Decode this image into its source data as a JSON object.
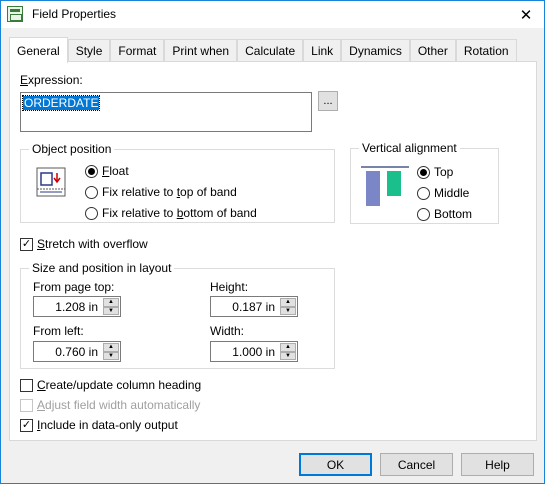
{
  "window": {
    "title": "Field Properties",
    "close_glyph": "✕"
  },
  "tabs": [
    {
      "label": "General",
      "active": true
    },
    {
      "label": "Style"
    },
    {
      "label": "Format"
    },
    {
      "label": "Print when"
    },
    {
      "label": "Calculate"
    },
    {
      "label": "Link"
    },
    {
      "label": "Dynamics"
    },
    {
      "label": "Other"
    },
    {
      "label": "Rotation"
    }
  ],
  "expression": {
    "label_underlined": "E",
    "label_rest": "xpression:",
    "value": "ORDERDATE",
    "browse_label": "..."
  },
  "object_position": {
    "title": "Object position",
    "icon": "object-position-icon",
    "options": [
      {
        "underlined": "F",
        "rest": "loat",
        "prefix": "",
        "selected": true
      },
      {
        "prefix": "Fix relative to ",
        "underlined": "t",
        "rest": "op of band",
        "selected": false
      },
      {
        "prefix": "Fix relative to ",
        "underlined": "b",
        "rest": "ottom of band",
        "selected": false
      }
    ]
  },
  "vertical_alignment": {
    "title": "Vertical alignment",
    "icon": "vertical-alignment-top-icon",
    "icon_colors": {
      "left_bar": "#7b86c6",
      "right_bar": "#1bbf8c",
      "top_line": "#4a5a8a"
    },
    "options": [
      {
        "label": "Top",
        "selected": true
      },
      {
        "label": "Middle",
        "selected": false
      },
      {
        "label": "Bottom",
        "selected": false
      }
    ]
  },
  "stretch": {
    "underlined": "S",
    "rest": "tretch with overflow",
    "checked": true
  },
  "size_position": {
    "title": "Size and position in layout",
    "from_page_top": {
      "label": "From page top:",
      "value": "1.208 in"
    },
    "height": {
      "label": "Height:",
      "value": "0.187 in"
    },
    "from_left": {
      "label": "From left:",
      "value": "0.760 in"
    },
    "width": {
      "label": "Width:",
      "value": "1.000 in"
    }
  },
  "create_heading": {
    "underlined": "C",
    "rest": "reate/update column heading",
    "checked": false
  },
  "adjust_width": {
    "underlined": "A",
    "rest": "djust field width automatically",
    "checked": false,
    "disabled": true
  },
  "include_data_only": {
    "underlined": "I",
    "rest": "nclude in data-only output",
    "checked": true
  },
  "buttons": {
    "ok": "OK",
    "cancel": "Cancel",
    "help": "Help"
  },
  "colors": {
    "accent": "#0078d7",
    "window_border": "#1883d7"
  }
}
